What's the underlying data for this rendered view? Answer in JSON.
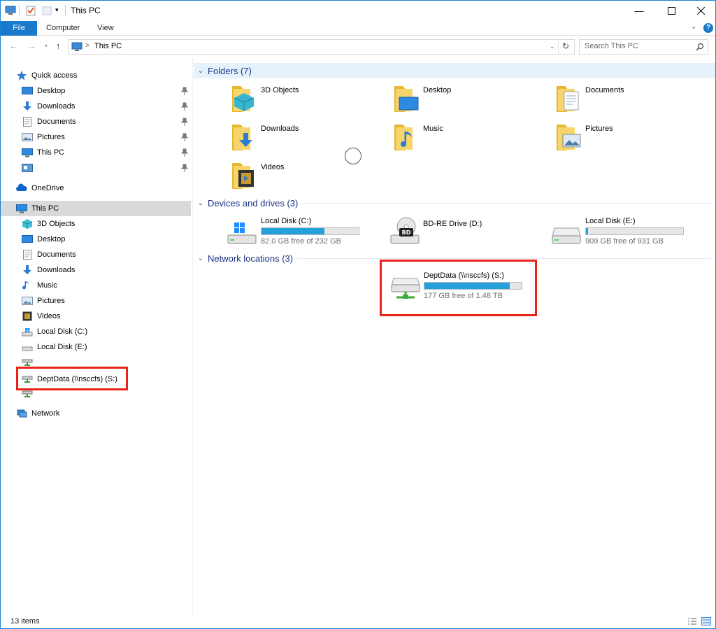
{
  "window": {
    "title": "This PC"
  },
  "ribbon": {
    "tabs": [
      "File",
      "Computer",
      "View"
    ]
  },
  "address": {
    "path_separator": ">",
    "path": "This PC",
    "search_placeholder": "Search This PC"
  },
  "nav": {
    "quick_access": "Quick access",
    "quick_items": [
      "Desktop",
      "Downloads",
      "Documents",
      "Pictures",
      "This PC",
      ""
    ],
    "onedrive": "OneDrive",
    "this_pc": "This PC",
    "pc_items": [
      "3D Objects",
      "Desktop",
      "Documents",
      "Downloads",
      "Music",
      "Pictures",
      "Videos",
      "Local Disk (C:)",
      "Local Disk (E:)",
      "",
      "DeptData (\\\\nsccfs) (S:)",
      ""
    ],
    "network": "Network"
  },
  "content": {
    "folders_header": "Folders (7)",
    "folders": [
      "3D Objects",
      "Desktop",
      "Documents",
      "Downloads",
      "Music",
      "Pictures",
      "Videos"
    ],
    "devices_header": "Devices and drives (3)",
    "drives": [
      {
        "name": "Local Disk (C:)",
        "free": "82.0 GB free of 232 GB",
        "used_fraction": 0.65
      },
      {
        "name": "BD-RE Drive (D:)",
        "free": "",
        "used_fraction": null
      },
      {
        "name": "Local Disk (E:)",
        "free": "909 GB free of 931 GB",
        "used_fraction": 0.02
      }
    ],
    "network_header": "Network locations (3)",
    "network_drive": {
      "name": "DeptData (\\\\nsccfs) (S:)",
      "free": "177 GB free of 1.48 TB",
      "used_fraction": 0.88
    }
  },
  "status": {
    "items": "13 items"
  },
  "colors": {
    "accent": "#1979ca",
    "highlight": "#e8231a",
    "progress": "#26a0da",
    "group_title": "#1e3287"
  }
}
